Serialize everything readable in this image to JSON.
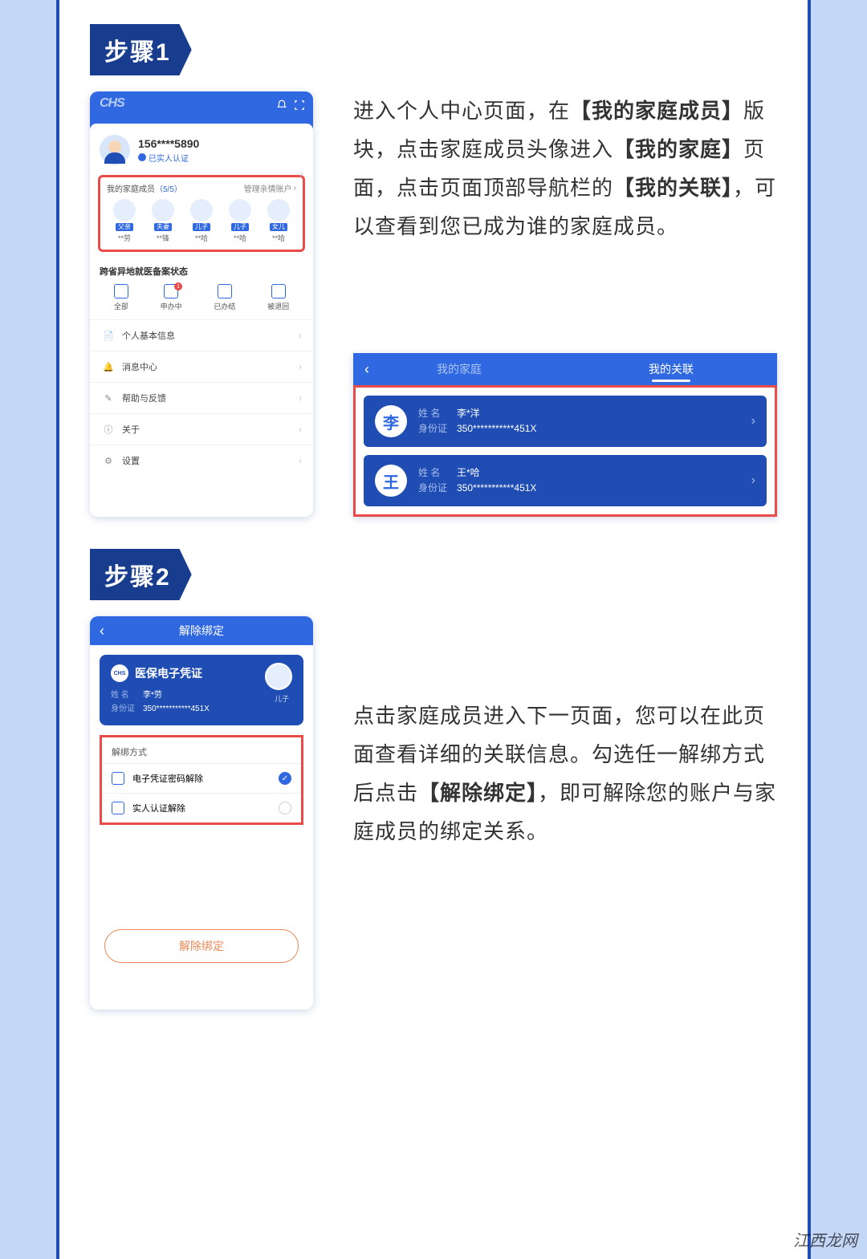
{
  "watermark": "江西龙网",
  "step1": {
    "badge": "步骤1",
    "desc_parts": {
      "t1": "进入个人中心页面，在",
      "b1": "【我的家庭成员】",
      "t2": "版块，点击家庭成员头像进入",
      "b2": "【我的家庭】",
      "t3": "页面，点击页面顶部导航栏的",
      "b3": "【我的关联】",
      "t4": "，可以查看到您已成为谁的家庭成员。"
    },
    "phone": {
      "logo": "CHS",
      "user_name": "156****5890",
      "user_badge": "已实人认证",
      "family": {
        "title": "我的家庭成员",
        "count": "（5/5）",
        "manage": "管理亲情账户",
        "members": [
          {
            "tag": "父亲",
            "name": "**劳"
          },
          {
            "tag": "夫妻",
            "name": "**锋"
          },
          {
            "tag": "儿子",
            "name": "**哈"
          },
          {
            "tag": "儿子",
            "name": "**哈"
          },
          {
            "tag": "女儿",
            "name": "**哈"
          }
        ]
      },
      "status": {
        "title": "跨省异地就医备案状态",
        "items": [
          {
            "label": "全部"
          },
          {
            "label": "申办中",
            "badge": "1"
          },
          {
            "label": "已办结"
          },
          {
            "label": "被退回"
          }
        ]
      },
      "menu": [
        {
          "icon": "📄",
          "label": "个人基本信息"
        },
        {
          "icon": "🔔",
          "label": "消息中心"
        },
        {
          "icon": "✎",
          "label": "帮助与反馈"
        },
        {
          "icon": "ⓘ",
          "label": "关于"
        },
        {
          "icon": "⚙",
          "label": "设置"
        }
      ]
    },
    "assoc": {
      "tab1": "我的家庭",
      "tab2": "我的关联",
      "people": [
        {
          "avatar": "李",
          "name_label": "姓 名",
          "name": "李*洋",
          "id_label": "身份证",
          "id": "350***********451X"
        },
        {
          "avatar": "王",
          "name_label": "姓 名",
          "name": "王*哈",
          "id_label": "身份证",
          "id": "350***********451X"
        }
      ]
    }
  },
  "step2": {
    "badge": "步骤2",
    "desc_parts": {
      "t1": "点击家庭成员进入下一页面，您可以在此页面查看详细的关联信息。勾选任一解绑方式后点击",
      "b1": "【解除绑定】",
      "t2": "，即可解除您的账户与家庭成员的绑定关系。"
    },
    "phone": {
      "title": "解除绑定",
      "card_title": "医保电子凭证",
      "chs": "CHS",
      "name_label": "姓 名",
      "name": "李*劳",
      "id_label": "身份证",
      "id": "350***********451X",
      "avatar_label": "儿子",
      "unbind_title": "解绑方式",
      "options": [
        {
          "label": "电子凭证密码解除",
          "checked": true
        },
        {
          "label": "实人认证解除",
          "checked": false
        }
      ],
      "button": "解除绑定"
    }
  }
}
